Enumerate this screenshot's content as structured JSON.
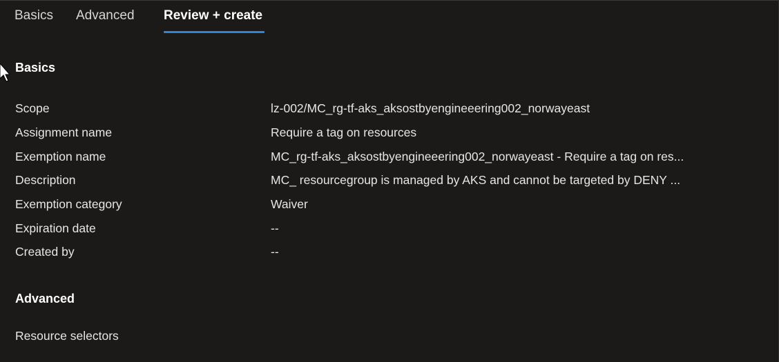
{
  "tabs": [
    {
      "label": "Basics",
      "active": false
    },
    {
      "label": "Advanced",
      "active": false
    },
    {
      "label": "Review + create",
      "active": true
    }
  ],
  "accent_color": "#2f86d9",
  "basics": {
    "title": "Basics",
    "rows": [
      {
        "label": "Scope",
        "value": "lz-002/MC_rg-tf-aks_aksostbyengineeering002_norwayeast"
      },
      {
        "label": "Assignment name",
        "value": "Require a tag on resources"
      },
      {
        "label": "Exemption name",
        "value": "MC_rg-tf-aks_aksostbyengineeering002_norwayeast - Require a tag on res..."
      },
      {
        "label": "Description",
        "value": "MC_ resourcegroup is managed by AKS and cannot be targeted by DENY ..."
      },
      {
        "label": "Exemption category",
        "value": "Waiver"
      },
      {
        "label": "Expiration date",
        "value": "--"
      },
      {
        "label": "Created by",
        "value": "--"
      }
    ]
  },
  "advanced": {
    "title": "Advanced",
    "rows": [
      {
        "label": "Resource selectors",
        "value": ""
      }
    ]
  }
}
